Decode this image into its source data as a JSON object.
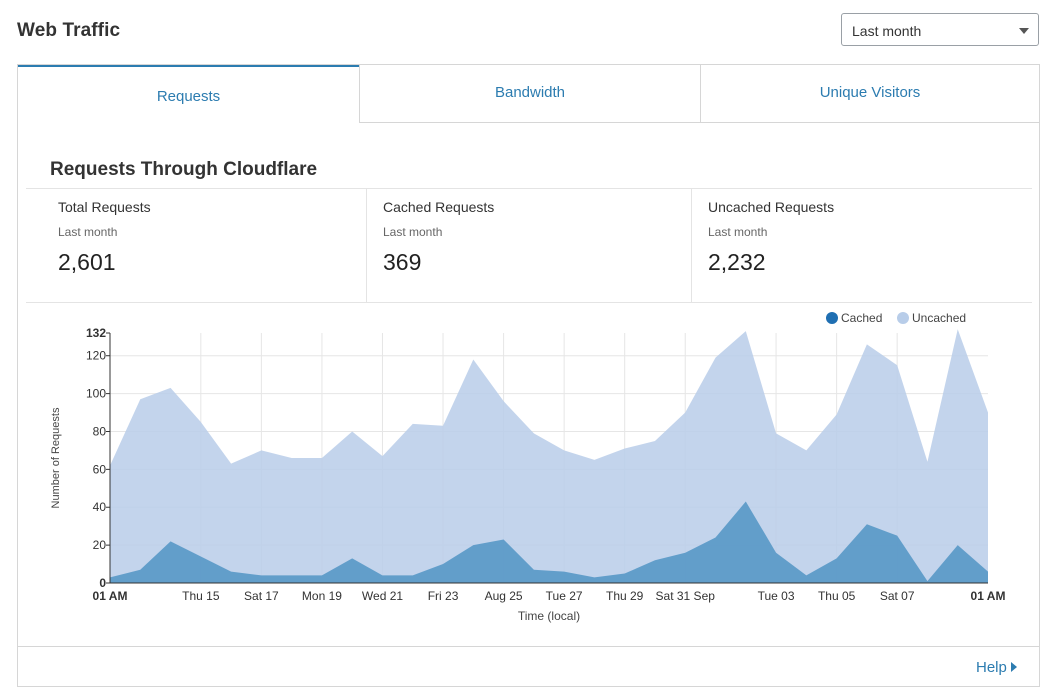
{
  "header": {
    "title": "Web Traffic"
  },
  "range_select": {
    "value": "Last month"
  },
  "tabs": [
    {
      "label": "Requests",
      "active": true
    },
    {
      "label": "Bandwidth",
      "active": false
    },
    {
      "label": "Unique Visitors",
      "active": false
    }
  ],
  "panel": {
    "title": "Requests Through Cloudflare",
    "stats": [
      {
        "label": "Total Requests",
        "period": "Last month",
        "value": "2,601"
      },
      {
        "label": "Cached Requests",
        "period": "Last month",
        "value": "369"
      },
      {
        "label": "Uncached Requests",
        "period": "Last month",
        "value": "2,232"
      }
    ]
  },
  "footer": {
    "help_label": "Help"
  },
  "colors": {
    "accent": "#2c7cb0",
    "cached": "#1f6fb2",
    "uncached": "#b8cde9"
  },
  "chart_data": {
    "type": "area",
    "stacked": true,
    "ylabel": "Number of Requests",
    "xlabel": "Time (local)",
    "ylim": [
      0,
      132
    ],
    "yticks": [
      0,
      20,
      40,
      60,
      80,
      100,
      120,
      132
    ],
    "xlim": [
      0,
      29
    ],
    "xticks": [
      {
        "x": 0,
        "label": "01 AM",
        "bold": true
      },
      {
        "x": 3,
        "label": "Thu 15"
      },
      {
        "x": 5,
        "label": "Sat 17"
      },
      {
        "x": 7,
        "label": "Mon 19"
      },
      {
        "x": 9,
        "label": "Wed 21"
      },
      {
        "x": 11,
        "label": "Fri 23"
      },
      {
        "x": 13,
        "label": "Aug 25"
      },
      {
        "x": 15,
        "label": "Tue 27"
      },
      {
        "x": 17,
        "label": "Thu 29"
      },
      {
        "x": 19,
        "label": "Sat 31 Sep"
      },
      {
        "x": 22,
        "label": "Tue 03"
      },
      {
        "x": 24,
        "label": "Thu 05"
      },
      {
        "x": 26,
        "label": "Sat 07"
      },
      {
        "x": 29,
        "label": "01 AM",
        "bold": true
      }
    ],
    "x": [
      0,
      1,
      2,
      3,
      4,
      5,
      6,
      7,
      8,
      9,
      10,
      11,
      12,
      13,
      14,
      15,
      16,
      17,
      18,
      19,
      20,
      21,
      22,
      23,
      24,
      25,
      26,
      27,
      28,
      29
    ],
    "legend_position": "top-right",
    "grid": true,
    "series": [
      {
        "name": "Cached",
        "values": [
          3,
          7,
          22,
          14,
          6,
          4,
          4,
          4,
          13,
          4,
          4,
          10,
          20,
          23,
          7,
          6,
          3,
          5,
          12,
          16,
          24,
          43,
          16,
          4,
          13,
          31,
          25,
          1,
          20,
          6
        ]
      },
      {
        "name": "Uncached",
        "values": [
          59,
          90,
          81,
          71,
          57,
          66,
          62,
          62,
          67,
          63,
          80,
          73,
          98,
          73,
          72,
          64,
          62,
          66,
          63,
          74,
          95,
          90,
          63,
          66,
          76,
          95,
          90,
          63,
          114,
          84
        ]
      }
    ]
  }
}
